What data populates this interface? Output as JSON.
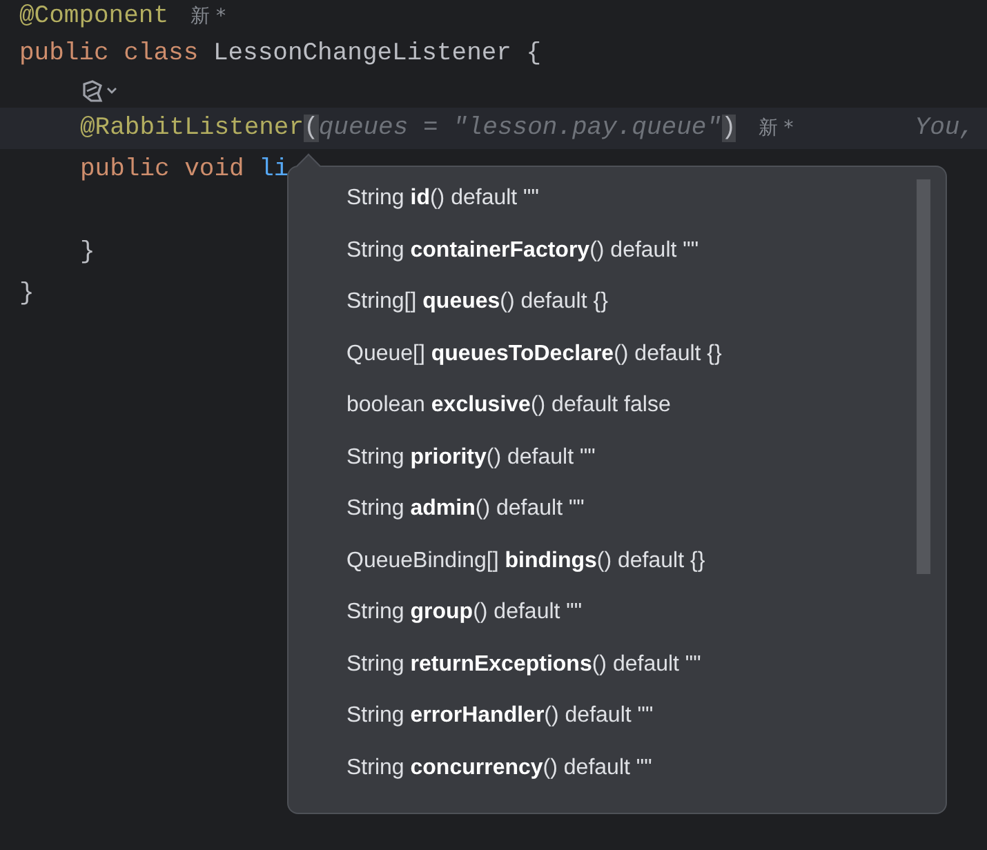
{
  "editor": {
    "lines": [
      {
        "kind": "code",
        "segments": [
          {
            "kind": "annotation",
            "text": "@Component"
          },
          {
            "kind": "hint",
            "text": "新 *"
          }
        ]
      },
      {
        "kind": "code",
        "segments": [
          {
            "kind": "keyword",
            "text": "public class "
          },
          {
            "kind": "plain",
            "text": "LessonChangeListener {"
          }
        ],
        "children": [
          {
            "kind": "icon"
          },
          {
            "kind": "code",
            "current": true,
            "segments": [
              {
                "kind": "annotation",
                "text": "@RabbitListener"
              },
              {
                "kind": "brace_match",
                "text": "("
              },
              {
                "kind": "param",
                "text": "queues = \"lesson.pay.queue\""
              },
              {
                "kind": "brace_match",
                "text": ")"
              },
              {
                "kind": "hint",
                "text": "新 *"
              },
              {
                "kind": "author",
                "text": "You,"
              }
            ]
          },
          {
            "kind": "code",
            "segments": [
              {
                "kind": "keyword",
                "text": "public void "
              },
              {
                "kind": "method",
                "text": "li"
              }
            ]
          },
          {
            "kind": "blank"
          },
          {
            "kind": "code",
            "segments": [
              {
                "kind": "plain",
                "text": "}"
              }
            ]
          }
        ]
      },
      {
        "kind": "code",
        "segments": [
          {
            "kind": "plain",
            "text": "}"
          }
        ]
      }
    ]
  },
  "completion_popup": {
    "items": [
      {
        "text": "String **id**() default \"\""
      },
      {
        "text": "String **containerFactory**() default \"\""
      },
      {
        "text": "String[] **queues**() default {}"
      },
      {
        "text": "Queue[] **queuesToDeclare**() default {}"
      },
      {
        "text": "boolean **exclusive**() default false"
      },
      {
        "text": "String **priority**() default \"\""
      },
      {
        "text": "String **admin**() default \"\""
      },
      {
        "text": "QueueBinding[] **bindings**() default {}"
      },
      {
        "text": "String **group**() default \"\""
      },
      {
        "text": "String **returnExceptions**() default \"\""
      },
      {
        "text": "String **errorHandler**() default \"\""
      },
      {
        "text": "String **concurrency**() default \"\""
      }
    ]
  }
}
